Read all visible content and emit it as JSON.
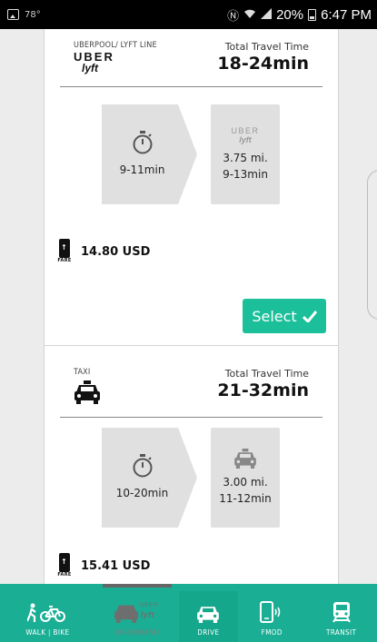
{
  "status_bar": {
    "temperature": "78°",
    "battery": "20%",
    "time": "6:47 PM"
  },
  "cards": [
    {
      "provider_label": "UBERPOOL/ LYFT LINE",
      "logo_top": "UBER",
      "logo_bottom": "lyft",
      "travel_label": "Total Travel Time",
      "travel_time": "18-24min",
      "walk_time": "9-11min",
      "ride_distance": "3.75 mi.",
      "ride_time": "9-13min",
      "ride_logo_top": "UBER",
      "ride_logo_bottom": "lyft",
      "fare_label": "FARE",
      "fare": "14.80 USD",
      "select_label": "Select"
    },
    {
      "provider_label": "TAXI",
      "travel_label": "Total Travel Time",
      "travel_time": "21-32min",
      "walk_time": "10-20min",
      "ride_distance": "3.00 mi.",
      "ride_time": "11-12min",
      "fare_label": "FARE",
      "fare": "15.41 USD"
    }
  ],
  "nav": [
    {
      "label": "WALK | BIKE",
      "icon": "walk-bike-icon",
      "state": "normal"
    },
    {
      "label": "ON-DEMAND",
      "icon": "car-uber-lyft-icon",
      "state": "disabled",
      "badge_top": "UBER",
      "badge_bottom": "lyft"
    },
    {
      "label": "DRIVE",
      "icon": "car-icon",
      "state": "active"
    },
    {
      "label": "FMOD",
      "icon": "phone-signal-icon",
      "state": "normal"
    },
    {
      "label": "TRANSIT",
      "icon": "train-icon",
      "state": "normal"
    }
  ],
  "colors": {
    "accent": "#1bbf9a",
    "nav_background": "#1aaf95",
    "segment_gray": "#e0e0e0"
  }
}
